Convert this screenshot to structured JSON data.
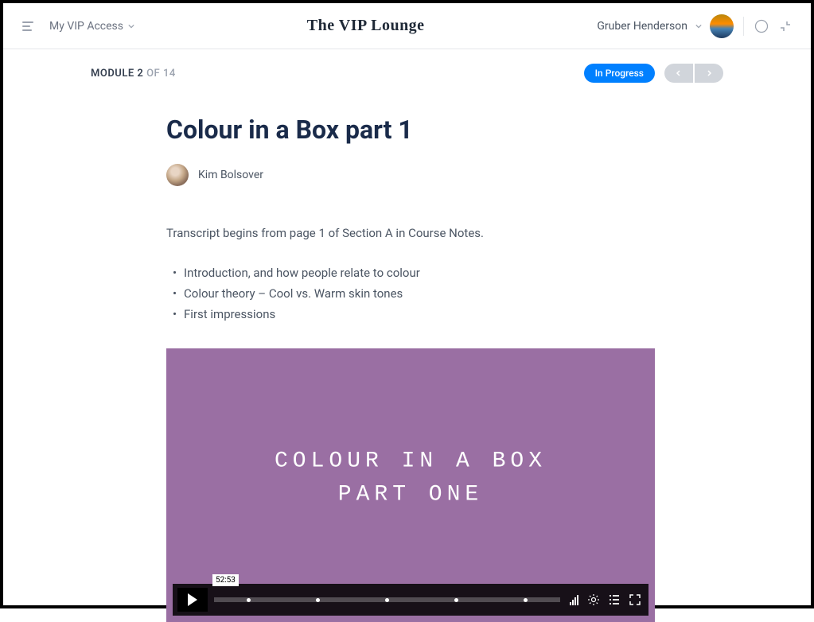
{
  "header": {
    "vip_access": "My VIP Access",
    "brand": "The VIP Lounge",
    "user_name": "Gruber Henderson"
  },
  "module": {
    "label": "MODULE 2",
    "total": " OF 14",
    "status": "In Progress"
  },
  "content": {
    "title": "Colour in a Box part 1",
    "author": "Kim Bolsover",
    "transcript_note": "Transcript begins from page 1 of Section A in Course Notes.",
    "bullets": [
      "Introduction, and how people relate to colour",
      "Colour theory – Cool vs. Warm skin tones",
      "First impressions"
    ]
  },
  "video": {
    "title_line1": "COLOUR IN A BOX",
    "title_line2": "PART ONE",
    "duration": "52:53"
  }
}
